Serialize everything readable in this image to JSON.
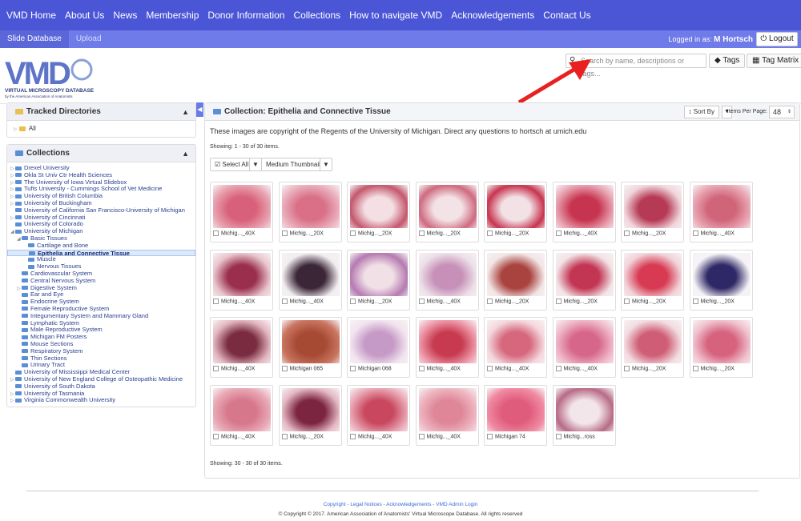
{
  "topnav": [
    "VMD Home",
    "About Us",
    "News",
    "Membership",
    "Donor Information",
    "Collections",
    "How to navigate VMD",
    "Acknowledgements",
    "Contact Us"
  ],
  "subnav": {
    "tab_active": "Slide Database",
    "tab_upload": "Upload",
    "logged_prefix": "Logged in as:",
    "user": "M Hortsch",
    "logout": "Logout"
  },
  "logo": {
    "letters": "VMD",
    "line1": "VIRTUAL MICROSCOPY DATABASE",
    "line2": "by the American Association of Anatomists"
  },
  "search": {
    "placeholder": "Search by name, descriptions or tags...",
    "tags_label": "Tags",
    "tag_matrix_label": "Tag Matrix"
  },
  "tracked": {
    "title": "Tracked Directories",
    "all": "All"
  },
  "collections": {
    "title": "Collections",
    "items": [
      {
        "label": "Drexel University",
        "lvl": 0,
        "ex": "▷"
      },
      {
        "label": "Okla St Univ Ctr Health Sciences",
        "lvl": 0,
        "ex": "▷"
      },
      {
        "label": "The University of Iowa Virtual Slidebox",
        "lvl": 0,
        "ex": "▷"
      },
      {
        "label": "Tufts University - Cummings School of Vet Medicine",
        "lvl": 0,
        "ex": "▷"
      },
      {
        "label": "University of British Columbia",
        "lvl": 0,
        "ex": "▷"
      },
      {
        "label": "University of Buckingham",
        "lvl": 0,
        "ex": "▷"
      },
      {
        "label": "University of California San Francisco-University of Michigan",
        "lvl": 0,
        "ex": ""
      },
      {
        "label": "University of Cincinnati",
        "lvl": 0,
        "ex": "▷"
      },
      {
        "label": "University of Colorado",
        "lvl": 0,
        "ex": ""
      },
      {
        "label": "University of Michigan",
        "lvl": 0,
        "ex": "◢"
      },
      {
        "label": "Basic Tissues",
        "lvl": 1,
        "ex": "◢"
      },
      {
        "label": "Cartilage and Bone",
        "lvl": 2,
        "ex": ""
      },
      {
        "label": "Epithelia and Connective Tissue",
        "lvl": 2,
        "ex": "",
        "sel": true
      },
      {
        "label": "Muscle",
        "lvl": 2,
        "ex": ""
      },
      {
        "label": "Nervous Tissues",
        "lvl": 2,
        "ex": ""
      },
      {
        "label": "Cardiovascular System",
        "lvl": 1,
        "ex": ""
      },
      {
        "label": "Central Nervous System",
        "lvl": 1,
        "ex": ""
      },
      {
        "label": "Digestive System",
        "lvl": 1,
        "ex": "▷"
      },
      {
        "label": "Ear and Eye",
        "lvl": 1,
        "ex": ""
      },
      {
        "label": "Endocrine System",
        "lvl": 1,
        "ex": ""
      },
      {
        "label": "Female Reproductive System",
        "lvl": 1,
        "ex": ""
      },
      {
        "label": "Integumentary System and Mammary Gland",
        "lvl": 1,
        "ex": ""
      },
      {
        "label": "Lymphatic System",
        "lvl": 1,
        "ex": ""
      },
      {
        "label": "Male Reproductive System",
        "lvl": 1,
        "ex": ""
      },
      {
        "label": "Michigan FM Posters",
        "lvl": 1,
        "ex": ""
      },
      {
        "label": "Mouse Sections",
        "lvl": 1,
        "ex": ""
      },
      {
        "label": "Respiratory System",
        "lvl": 1,
        "ex": ""
      },
      {
        "label": "Thin Sections",
        "lvl": 1,
        "ex": ""
      },
      {
        "label": "Urinary Tract",
        "lvl": 1,
        "ex": ""
      },
      {
        "label": "University of Mississippi Medical Center",
        "lvl": 0,
        "ex": ""
      },
      {
        "label": "University of New England College of Osteopathic Medicine",
        "lvl": 0,
        "ex": "▷"
      },
      {
        "label": "University of South Dakota",
        "lvl": 0,
        "ex": ""
      },
      {
        "label": "University of Tasmania",
        "lvl": 0,
        "ex": "▷"
      },
      {
        "label": "Virginia Commonwealth University",
        "lvl": 0,
        "ex": "▷"
      }
    ]
  },
  "main": {
    "title": "Collection: Epithelia and Connective Tissue",
    "sort_label": "Sort By",
    "items_per_page_label": "Items Per Page:",
    "items_per_page": "48",
    "copyright_note": "These images are copyright of the Regents of the University of Michigan. Direct any questions to hortsch at umich.edu",
    "showing_top": "Showing: 1 - 30 of 30 items.",
    "showing_bottom": "Showing: 30 - 30 of 30 items.",
    "select_all": "Select All",
    "thumb_size": "Medium Thumbnails",
    "thumbs": [
      {
        "cap": "Michig..._40X",
        "c1": "#d9607a",
        "c2": "#e8a3b1"
      },
      {
        "cap": "Michig..._20X",
        "c1": "#d97088",
        "c2": "#eab0bd"
      },
      {
        "cap": "Michig..._20X",
        "c1": "#f4dfe4",
        "c2": "#c4576c"
      },
      {
        "cap": "Michig..._20X",
        "c1": "#f3e2e6",
        "c2": "#cf6a7f"
      },
      {
        "cap": "Michig..._20X",
        "c1": "#f2e2e6",
        "c2": "#c7344f"
      },
      {
        "cap": "Michig..._40X",
        "c1": "#c7344f",
        "c2": "#e7a2b0"
      },
      {
        "cap": "Michig..._20X",
        "c1": "#b63a55",
        "c2": "#f0d6dc"
      },
      {
        "cap": "Michig..._40X",
        "c1": "#d0657a",
        "c2": "#e9a7b4"
      },
      {
        "cap": "Michig..._40X",
        "c1": "#9a2f4d",
        "c2": "#e9c7cf"
      },
      {
        "cap": "Michig..._40X",
        "c1": "#3b2638",
        "c2": "#f2eef0"
      },
      {
        "cap": "Michig..._20X",
        "c1": "#f1e0e6",
        "c2": "#b57ab1"
      },
      {
        "cap": "Michig..._40X",
        "c1": "#c690b8",
        "c2": "#ede0e8"
      },
      {
        "cap": "Michig..._20X",
        "c1": "#a9433f",
        "c2": "#f2e6e6"
      },
      {
        "cap": "Michig..._20X",
        "c1": "#c23553",
        "c2": "#f2e3e6"
      },
      {
        "cap": "Michig..._20X",
        "c1": "#d73a52",
        "c2": "#f1d3d9"
      },
      {
        "cap": "Michig..._20X",
        "c1": "#2f2866",
        "c2": "#f5f3f6"
      },
      {
        "cap": "Michig..._40X",
        "c1": "#7a2b3f",
        "c2": "#e3b7c1"
      },
      {
        "cap": "Michigan 065",
        "c1": "#a64a34",
        "c2": "#c97560"
      },
      {
        "cap": "Michigan 068",
        "c1": "#c59ac6",
        "c2": "#f2e4ef"
      },
      {
        "cap": "Michig..._40X",
        "c1": "#c73a50",
        "c2": "#ee9aaa"
      },
      {
        "cap": "Michig..._40X",
        "c1": "#d6677c",
        "c2": "#f4d8de"
      },
      {
        "cap": "Michig..._40X",
        "c1": "#d7678a",
        "c2": "#efb8c8"
      },
      {
        "cap": "Michig..._20X",
        "c1": "#cf5d75",
        "c2": "#f2dce1"
      },
      {
        "cap": "Michig..._20X",
        "c1": "#d6627e",
        "c2": "#f0c2ce"
      },
      {
        "cap": "Michig..._40X",
        "c1": "#d7778c",
        "c2": "#e9aab7"
      },
      {
        "cap": "Michig..._20X",
        "c1": "#7c2540",
        "c2": "#e4b8c4"
      },
      {
        "cap": "Michig..._40X",
        "c1": "#c9485f",
        "c2": "#e9a6b4"
      },
      {
        "cap": "Michig..._40X",
        "c1": "#df8799",
        "c2": "#eeb7c2"
      },
      {
        "cap": "Michigan 74",
        "c1": "#e05c7c",
        "c2": "#f08aa2"
      },
      {
        "cap": "Michig...ross",
        "c1": "#f3e6ea",
        "c2": "#b76a86"
      }
    ]
  },
  "footer": {
    "links": "Copyright - Legal Notices - Acknowledgements - VMD Admin Login",
    "copyright": "© Copyright © 2017. American Association of Anatomists' Virtual Microscope Database. All rights reserved"
  },
  "colors": {
    "nav": "#4a56d6",
    "subnav": "#6f7be8",
    "arrow": "#e82020"
  }
}
